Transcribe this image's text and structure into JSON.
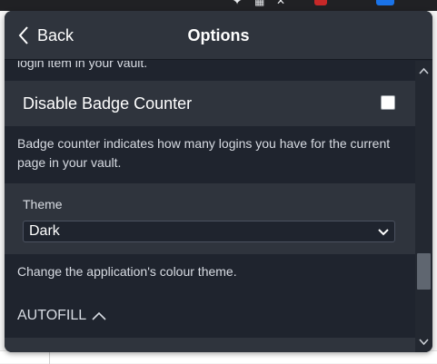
{
  "header": {
    "back_label": "Back",
    "title": "Options"
  },
  "settings": {
    "cut_off_text": "login item in your vault.",
    "badge_counter": {
      "label": "Disable Badge Counter",
      "checked": false,
      "help": "Badge counter indicates how many logins you have for the current page in your vault."
    },
    "theme": {
      "label": "Theme",
      "selected": "Dark",
      "help": "Change the application's colour theme."
    },
    "autofill_section": {
      "label": "AUTOFILL"
    }
  },
  "icons": {
    "back": "chevron-left-icon",
    "select": "chevron-down-icon",
    "section": "chevron-up-icon"
  },
  "colors": {
    "background": "#1f242e",
    "panel": "#2f343d",
    "text": "#ffffff",
    "muted_text": "#d8dce3"
  }
}
